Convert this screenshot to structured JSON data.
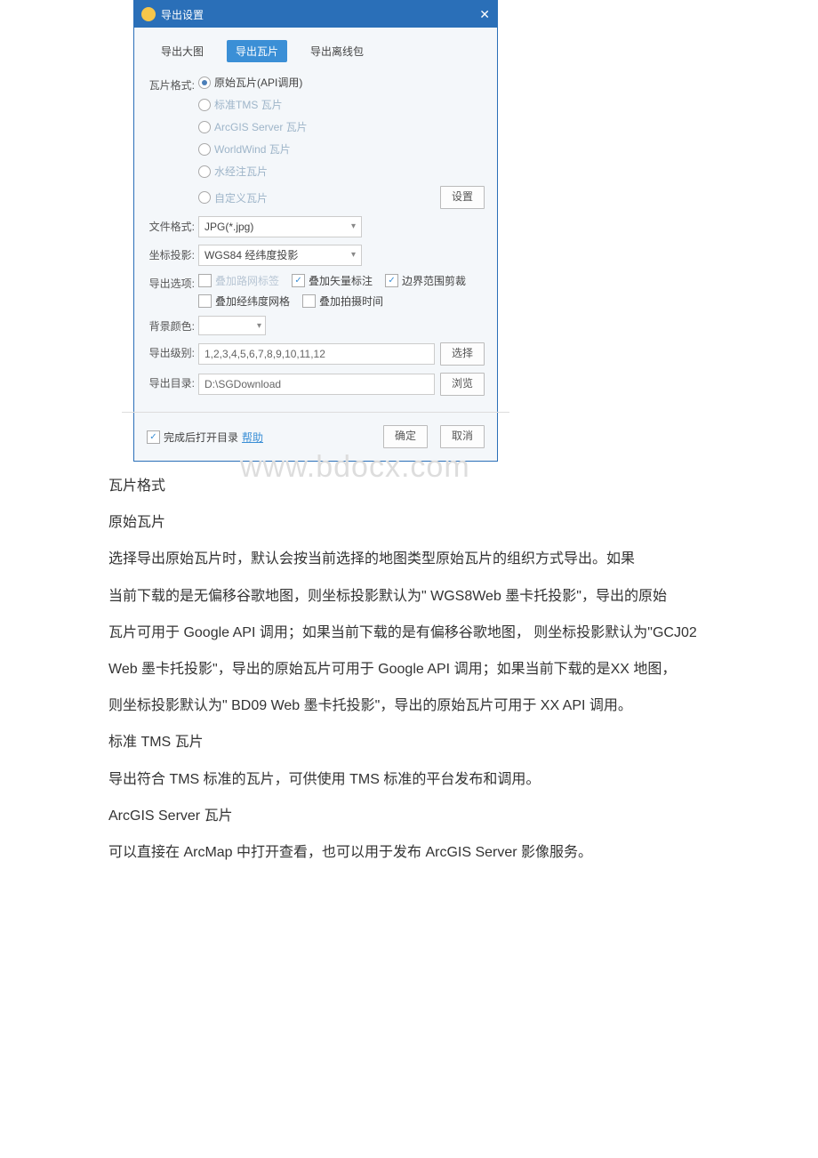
{
  "dialog": {
    "title": "导出设置",
    "tabs": {
      "big": "导出大图",
      "tiles": "导出瓦片",
      "offline": "导出离线包"
    },
    "tileFormat": {
      "label": "瓦片格式:",
      "raw": "原始瓦片(API调用)",
      "tms": "标准TMS 瓦片",
      "arcgis": "ArcGIS Server 瓦片",
      "worldwind": "WorldWind 瓦片",
      "water": "水经注瓦片",
      "custom": "自定义瓦片",
      "settingsBtn": "设置"
    },
    "fileFormat": {
      "label": "文件格式:",
      "value": "JPG(*.jpg)"
    },
    "projection": {
      "label": "坐标投影:",
      "value": "WGS84 经纬度投影"
    },
    "options": {
      "label": "导出选项:",
      "roadLabel": "叠加路网标签",
      "vectorLabel": "叠加矢量标注",
      "boundaryCrop": "边界范围剪裁",
      "lonlatGrid": "叠加经纬度网格",
      "shootTime": "叠加拍摄时间"
    },
    "bgColor": {
      "label": "背景颜色:"
    },
    "levels": {
      "label": "导出级别:",
      "value": "1,2,3,4,5,6,7,8,9,10,11,12",
      "btn": "选择"
    },
    "outDir": {
      "label": "导出目录:",
      "value": "D:\\SGDownload",
      "btn": "浏览"
    },
    "footer": {
      "openAfter": "完成后打开目录",
      "help": "帮助",
      "ok": "确定",
      "cancel": "取消"
    }
  },
  "watermark": "www.bdocx.com",
  "article": {
    "p1": "瓦片格式",
    "p2": "原始瓦片",
    "p3": "选择导出原始瓦片时，默认会按当前选择的地图类型原始瓦片的组织方式导出。如果",
    "p4": "当前下载的是无偏移谷歌地图，则坐标投影默认为\" WGS8Web 墨卡托投影\"，导出的原始",
    "p5": "瓦片可用于 Google API 调用；如果当前下载的是有偏移谷歌地图， 则坐标投影默认为\"GCJ02",
    "p6": "Web 墨卡托投影\"，导出的原始瓦片可用于 Google API 调用；如果当前下载的是XX 地图，",
    "p7": "则坐标投影默认为\" BD09 Web 墨卡托投影\"，导出的原始瓦片可用于 XX API 调用。",
    "p8": "标准 TMS 瓦片",
    "p9": "导出符合 TMS 标准的瓦片，可供使用 TMS 标准的平台发布和调用。",
    "p10": "ArcGIS Server 瓦片",
    "p11": "可以直接在 ArcMap 中打开查看，也可以用于发布 ArcGIS Server 影像服务。"
  }
}
